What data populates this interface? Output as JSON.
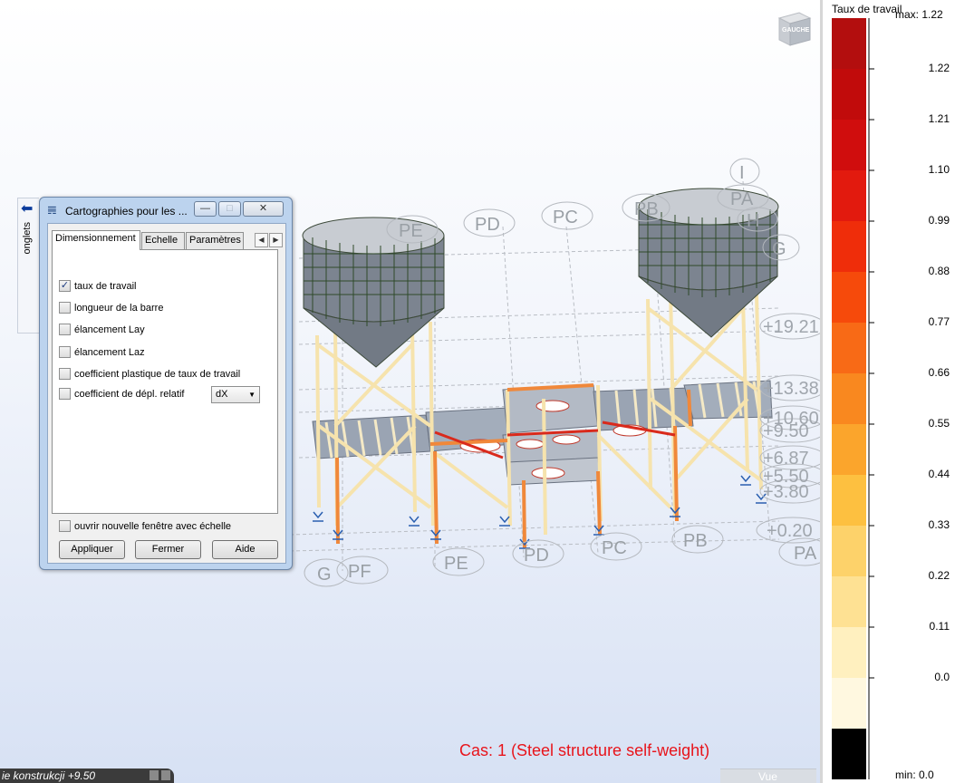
{
  "viewport": {
    "viewcube_label": "GAUCHE",
    "grid_labels_top": [
      "PE",
      "PD",
      "PC",
      "PB",
      "PA"
    ],
    "grid_labels_bottom": [
      "G",
      "PF",
      "PE",
      "PD",
      "PC",
      "PB",
      "PA"
    ],
    "grid_labels_right_top": [
      "I",
      "H",
      "G"
    ],
    "level_labels": [
      "+19.21",
      "+13.38",
      "+10.60",
      "+9.50",
      "+6.87",
      "+5.50",
      "+3.80",
      "+0.20"
    ],
    "case_label": "Cas: 1 (Steel structure self-weight)"
  },
  "side_tab": {
    "label": "onglets"
  },
  "dialog": {
    "title": "Cartographies pour les ...",
    "tabs": [
      "Dimensionnement",
      "Echelle",
      "Paramètres"
    ],
    "options": [
      {
        "label": "taux de travail",
        "checked": true
      },
      {
        "label": "longueur de la barre",
        "checked": false
      },
      {
        "label": "élancement Lay",
        "checked": false
      },
      {
        "label": "élancement Laz",
        "checked": false
      },
      {
        "label": "coefficient plastique de taux de travail",
        "checked": false
      },
      {
        "label": "coefficient de dépl. relatif",
        "checked": false
      }
    ],
    "combo_value": "dX",
    "new_window_label": "ouvrir nouvelle fenêtre avec échelle",
    "buttons": {
      "apply": "Appliquer",
      "close": "Fermer",
      "help": "Aide"
    }
  },
  "legend": {
    "title": "Taux de travail",
    "max_label": "max: 1.22",
    "min_label": "min:  0.0",
    "values": [
      "1.22",
      "1.21",
      "1.10",
      "0.99",
      "0.88",
      "0.77",
      "0.66",
      "0.55",
      "0.44",
      "0.33",
      "0.22",
      "0.11",
      "0.0"
    ],
    "colors": [
      "#b30e0e",
      "#c10b0b",
      "#d00d0d",
      "#e21a0e",
      "#ef2d0a",
      "#f64a0b",
      "#f86a16",
      "#f9881f",
      "#fba52c",
      "#fdc040",
      "#fdd26a",
      "#fee193",
      "#fff0bf",
      "#fff8e0",
      "#000000"
    ]
  },
  "statusbar": {
    "text": "ie konstrukcji +9.50",
    "view_button": "Vue"
  }
}
